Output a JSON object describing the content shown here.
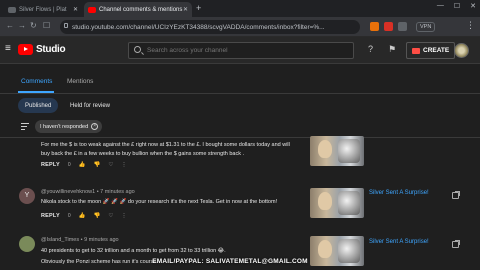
{
  "browser": {
    "tabs": [
      {
        "title": "Silver Flows | Plat",
        "favicon": "youtube-icon"
      },
      {
        "title": "Channel comments & mentions",
        "favicon": "youtube-icon"
      }
    ],
    "url": "studio.youtube.com/channel/UCIzYEzKT34388/scvgVADDA/comments/inbox?filter=%...",
    "vpn_label": "VPN"
  },
  "header": {
    "logo_text": "Studio",
    "search_placeholder": "Search across your channel",
    "create_label": "CREATE"
  },
  "tabs": [
    {
      "label": "Comments",
      "active": true
    },
    {
      "label": "Mentions",
      "active": false
    }
  ],
  "chips": [
    {
      "label": "Published",
      "selected": true
    },
    {
      "label": "Held for review",
      "selected": false
    }
  ],
  "filter": {
    "chip_label": "I haven't responded"
  },
  "comments": [
    {
      "author": "",
      "text": "For me the $ is too weak against the £ right now at $1.31 to the £. I bought some dollars today and will buy back the £ in a few weeks to buy bullion when the $ gains some strength back .",
      "reply_label": "REPLY",
      "reply_count": "0",
      "video_title": ""
    },
    {
      "avatar_letter": "Y",
      "avatar_color": "#6b4f4f",
      "author": "@youwillinevehknow1 • 7 minutes ago",
      "text": "Nikola stock to the moon 🚀 🚀 🚀 do your research it's the next Tesla. Get in now at the bottom!",
      "reply_label": "REPLY",
      "reply_count": "0",
      "video_title": "Silver Sent A Surprise!"
    },
    {
      "avatar_letter": "",
      "avatar_color": "#7a8a5a",
      "author": "@Island_Times • 9 minutes ago",
      "text": "40 presidents to get to 32 trillion and a month to get from 32 to 33 trillion 😂.",
      "text2": "Obviously the Ponzi scheme has run it's course",
      "video_title": "Silver Sent A Surprise!"
    }
  ],
  "banner": "EMAIL/PAYPAL: SALIVATEMETAL@GMAIL.COM"
}
